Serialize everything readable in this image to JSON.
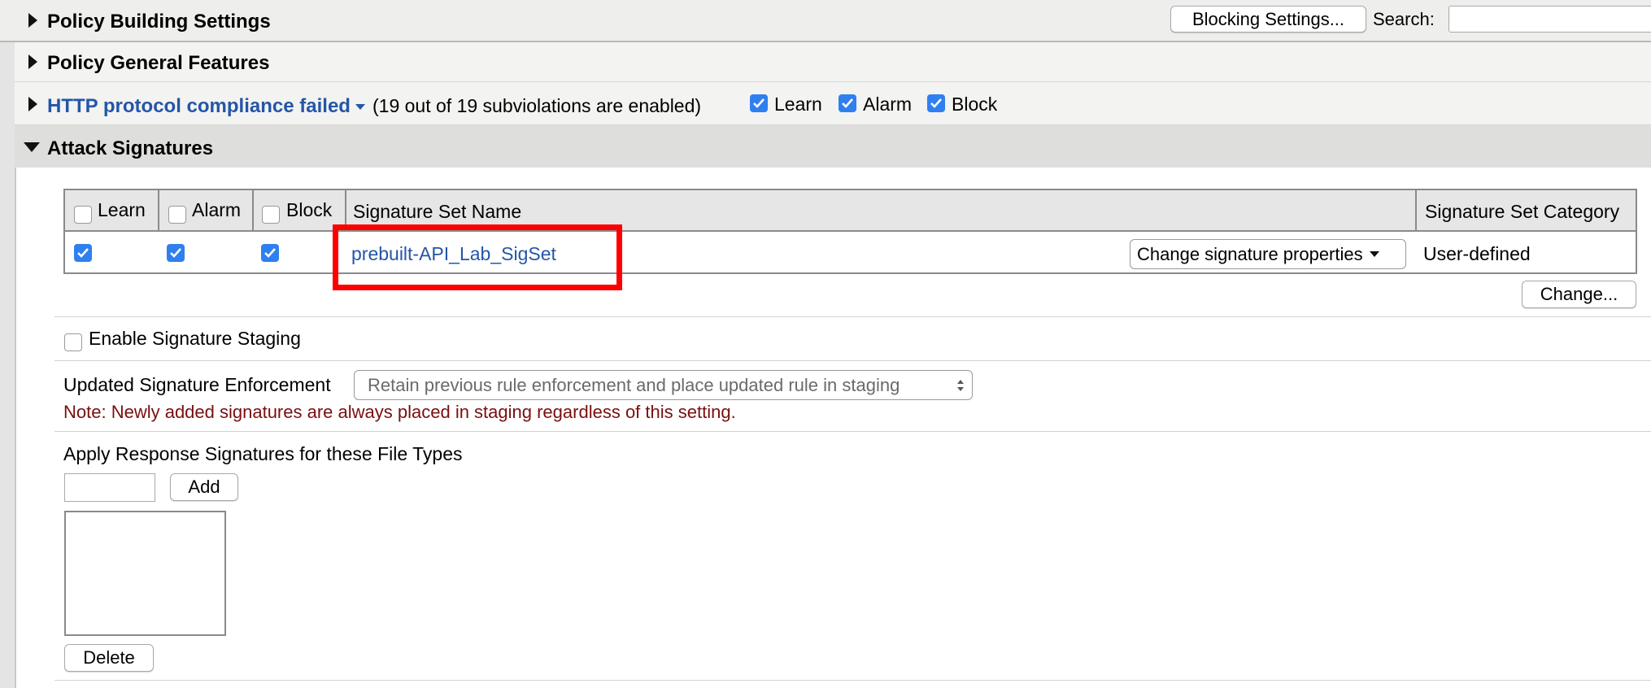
{
  "sections": {
    "policy_building": "Policy Building Settings",
    "policy_general": "Policy General Features",
    "http_violation": "HTTP protocol compliance failed",
    "http_subviolations": "(19 out of 19 subviolations are enabled)",
    "attack_signatures": "Attack Signatures"
  },
  "toolbar": {
    "blocking_settings_label": "Blocking Settings...",
    "search_label": "Search:",
    "search_value": ""
  },
  "http_flags": {
    "learn": "Learn",
    "alarm": "Alarm",
    "block": "Block"
  },
  "signature_table": {
    "headers": {
      "learn": "Learn",
      "alarm": "Alarm",
      "block": "Block",
      "set_name": "Signature Set Name",
      "set_category": "Signature Set Category"
    },
    "rows": [
      {
        "learn": true,
        "alarm": true,
        "block": true,
        "name": "prebuilt-API_Lab_SigSet",
        "action": "Change signature properties",
        "category": "User-defined"
      }
    ],
    "change_button": "Change..."
  },
  "staging": {
    "enable_label": "Enable Signature Staging",
    "enabled": false
  },
  "enforcement": {
    "label": "Updated Signature Enforcement",
    "value": "Retain previous rule enforcement and place updated rule in staging",
    "note": "Note: Newly added signatures are always placed in staging regardless of this setting."
  },
  "response_sigs": {
    "label": "Apply Response Signatures for these File Types",
    "input_value": "",
    "add_label": "Add",
    "delete_label": "Delete"
  },
  "colors": {
    "link_blue": "#2456a8",
    "checkbox_blue": "#2f7ff0",
    "note_red": "#7a0f0f",
    "highlight_red": "#ff0000"
  }
}
